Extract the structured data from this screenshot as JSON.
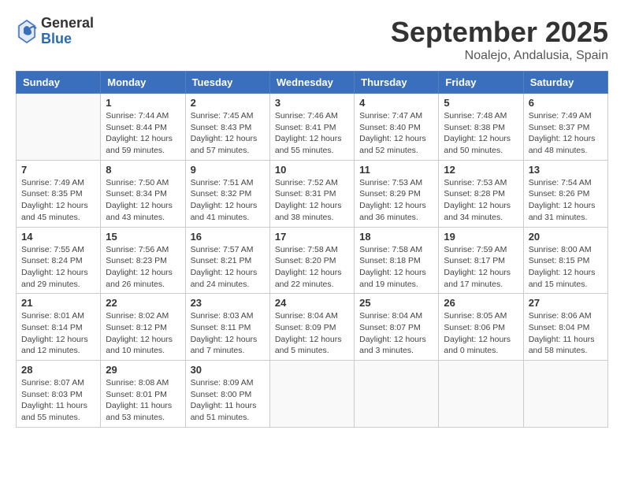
{
  "logo": {
    "general": "General",
    "blue": "Blue"
  },
  "title": "September 2025",
  "location": "Noalejo, Andalusia, Spain",
  "days_of_week": [
    "Sunday",
    "Monday",
    "Tuesday",
    "Wednesday",
    "Thursday",
    "Friday",
    "Saturday"
  ],
  "weeks": [
    [
      {
        "day": "",
        "info": ""
      },
      {
        "day": "1",
        "info": "Sunrise: 7:44 AM\nSunset: 8:44 PM\nDaylight: 12 hours\nand 59 minutes."
      },
      {
        "day": "2",
        "info": "Sunrise: 7:45 AM\nSunset: 8:43 PM\nDaylight: 12 hours\nand 57 minutes."
      },
      {
        "day": "3",
        "info": "Sunrise: 7:46 AM\nSunset: 8:41 PM\nDaylight: 12 hours\nand 55 minutes."
      },
      {
        "day": "4",
        "info": "Sunrise: 7:47 AM\nSunset: 8:40 PM\nDaylight: 12 hours\nand 52 minutes."
      },
      {
        "day": "5",
        "info": "Sunrise: 7:48 AM\nSunset: 8:38 PM\nDaylight: 12 hours\nand 50 minutes."
      },
      {
        "day": "6",
        "info": "Sunrise: 7:49 AM\nSunset: 8:37 PM\nDaylight: 12 hours\nand 48 minutes."
      }
    ],
    [
      {
        "day": "7",
        "info": "Sunrise: 7:49 AM\nSunset: 8:35 PM\nDaylight: 12 hours\nand 45 minutes."
      },
      {
        "day": "8",
        "info": "Sunrise: 7:50 AM\nSunset: 8:34 PM\nDaylight: 12 hours\nand 43 minutes."
      },
      {
        "day": "9",
        "info": "Sunrise: 7:51 AM\nSunset: 8:32 PM\nDaylight: 12 hours\nand 41 minutes."
      },
      {
        "day": "10",
        "info": "Sunrise: 7:52 AM\nSunset: 8:31 PM\nDaylight: 12 hours\nand 38 minutes."
      },
      {
        "day": "11",
        "info": "Sunrise: 7:53 AM\nSunset: 8:29 PM\nDaylight: 12 hours\nand 36 minutes."
      },
      {
        "day": "12",
        "info": "Sunrise: 7:53 AM\nSunset: 8:28 PM\nDaylight: 12 hours\nand 34 minutes."
      },
      {
        "day": "13",
        "info": "Sunrise: 7:54 AM\nSunset: 8:26 PM\nDaylight: 12 hours\nand 31 minutes."
      }
    ],
    [
      {
        "day": "14",
        "info": "Sunrise: 7:55 AM\nSunset: 8:24 PM\nDaylight: 12 hours\nand 29 minutes."
      },
      {
        "day": "15",
        "info": "Sunrise: 7:56 AM\nSunset: 8:23 PM\nDaylight: 12 hours\nand 26 minutes."
      },
      {
        "day": "16",
        "info": "Sunrise: 7:57 AM\nSunset: 8:21 PM\nDaylight: 12 hours\nand 24 minutes."
      },
      {
        "day": "17",
        "info": "Sunrise: 7:58 AM\nSunset: 8:20 PM\nDaylight: 12 hours\nand 22 minutes."
      },
      {
        "day": "18",
        "info": "Sunrise: 7:58 AM\nSunset: 8:18 PM\nDaylight: 12 hours\nand 19 minutes."
      },
      {
        "day": "19",
        "info": "Sunrise: 7:59 AM\nSunset: 8:17 PM\nDaylight: 12 hours\nand 17 minutes."
      },
      {
        "day": "20",
        "info": "Sunrise: 8:00 AM\nSunset: 8:15 PM\nDaylight: 12 hours\nand 15 minutes."
      }
    ],
    [
      {
        "day": "21",
        "info": "Sunrise: 8:01 AM\nSunset: 8:14 PM\nDaylight: 12 hours\nand 12 minutes."
      },
      {
        "day": "22",
        "info": "Sunrise: 8:02 AM\nSunset: 8:12 PM\nDaylight: 12 hours\nand 10 minutes."
      },
      {
        "day": "23",
        "info": "Sunrise: 8:03 AM\nSunset: 8:11 PM\nDaylight: 12 hours\nand 7 minutes."
      },
      {
        "day": "24",
        "info": "Sunrise: 8:04 AM\nSunset: 8:09 PM\nDaylight: 12 hours\nand 5 minutes."
      },
      {
        "day": "25",
        "info": "Sunrise: 8:04 AM\nSunset: 8:07 PM\nDaylight: 12 hours\nand 3 minutes."
      },
      {
        "day": "26",
        "info": "Sunrise: 8:05 AM\nSunset: 8:06 PM\nDaylight: 12 hours\nand 0 minutes."
      },
      {
        "day": "27",
        "info": "Sunrise: 8:06 AM\nSunset: 8:04 PM\nDaylight: 11 hours\nand 58 minutes."
      }
    ],
    [
      {
        "day": "28",
        "info": "Sunrise: 8:07 AM\nSunset: 8:03 PM\nDaylight: 11 hours\nand 55 minutes."
      },
      {
        "day": "29",
        "info": "Sunrise: 8:08 AM\nSunset: 8:01 PM\nDaylight: 11 hours\nand 53 minutes."
      },
      {
        "day": "30",
        "info": "Sunrise: 8:09 AM\nSunset: 8:00 PM\nDaylight: 11 hours\nand 51 minutes."
      },
      {
        "day": "",
        "info": ""
      },
      {
        "day": "",
        "info": ""
      },
      {
        "day": "",
        "info": ""
      },
      {
        "day": "",
        "info": ""
      }
    ]
  ]
}
